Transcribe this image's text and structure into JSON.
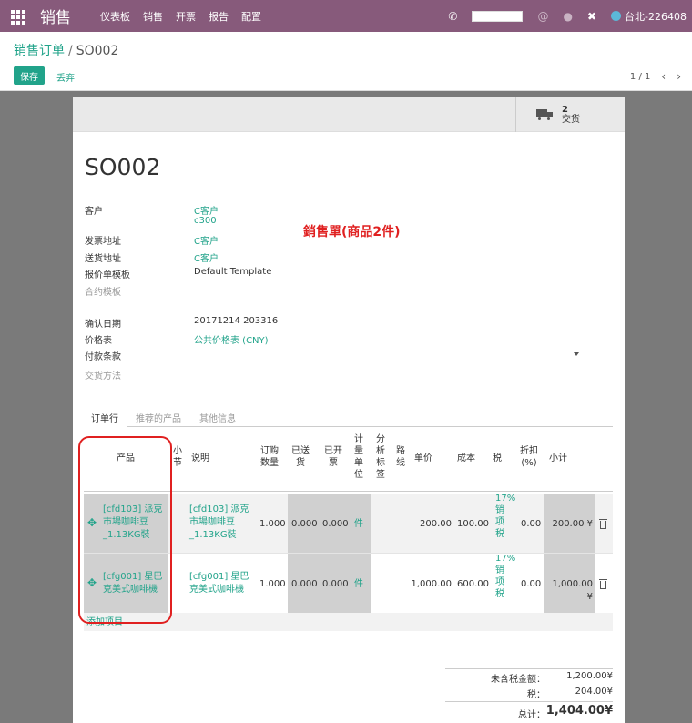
{
  "navbar": {
    "brand": "销售",
    "menu": [
      "仪表板",
      "销售",
      "开票",
      "报告",
      "配置"
    ],
    "user": "台北-226408",
    "icons": [
      "phone-icon",
      "search-field",
      "at-icon",
      "chat-icon",
      "close-icon"
    ]
  },
  "control": {
    "breadcrumb_parent": "销售订单",
    "breadcrumb_sep": "/",
    "breadcrumb_current": "SO002",
    "save_label": "保存",
    "discard_label": "丢弃",
    "pager": "1 / 1"
  },
  "smart_button": {
    "count": "2",
    "label": "交货"
  },
  "form": {
    "title": "SO002",
    "annotation": "銷售單(商品2件)",
    "fields": [
      {
        "label": "客户",
        "value": "C客户",
        "link": true
      },
      {
        "label": "",
        "value": "c300",
        "link": true
      },
      {
        "label": "发票地址",
        "value": "C客户",
        "link": true
      },
      {
        "label": "送货地址",
        "value": "C客户",
        "link": true
      },
      {
        "label": "报价单模板",
        "value": "Default Template",
        "link": false
      },
      {
        "label": "合约模板",
        "value": "",
        "link": false,
        "muted": true
      }
    ],
    "fields2": [
      {
        "label": "确认日期",
        "value": "20171214 203316",
        "link": false
      },
      {
        "label": "价格表",
        "value": "公共价格表 (CNY)",
        "link": true
      },
      {
        "label": "付款条款",
        "value": "",
        "link": false
      },
      {
        "label": "交货方法",
        "value": "",
        "link": false,
        "muted": true
      }
    ]
  },
  "tabs": [
    "订单行",
    "推荐的产品",
    "其他信息"
  ],
  "table": {
    "headers": {
      "product": "产品",
      "subtotal_flag": "小\n节",
      "description": "说明",
      "ordered": "订购\n数量",
      "delivered": "已送\n货",
      "invoiced": "已开\n票",
      "uom": "计\n量\n单\n位",
      "analytic": "分\n析\n标\n签",
      "route": "路\n线",
      "price": "单价",
      "cost": "成本",
      "tax": "税",
      "discount": "折扣\n(%)",
      "subtotal": "小计"
    },
    "rows": [
      {
        "product": "[cfd103] 派克市場咖啡豆_1.13KG裝",
        "description": "[cfd103] 派克市場咖啡豆_1.13KG裝",
        "ordered": "1.000",
        "delivered": "0.000",
        "invoiced": "0.000",
        "uom": "件",
        "price": "200.00",
        "cost": "100.00",
        "tax": "17%\n销\n项\n税",
        "discount": "0.00",
        "subtotal": "200.00 ¥"
      },
      {
        "product": "[cfg001] 星巴克美式咖啡機",
        "description": "[cfg001] 星巴克美式咖啡機",
        "ordered": "1.000",
        "delivered": "0.000",
        "invoiced": "0.000",
        "uom": "件",
        "price": "1,000.00",
        "cost": "600.00",
        "tax": "17%\n销\n项\n税",
        "discount": "0.00",
        "subtotal": "1,000.00 ¥"
      }
    ],
    "add_line": "添加项目"
  },
  "totals": {
    "untaxed_label": "未含税金额：",
    "untaxed_value": "1,200.00¥",
    "tax_label": "税：",
    "tax_value": "204.00¥",
    "total_label": "总计：",
    "total_value": "1,404.00¥"
  },
  "colors": {
    "navbar": "#875a7b",
    "accent": "#21a38a",
    "annotation": "#e02020"
  }
}
